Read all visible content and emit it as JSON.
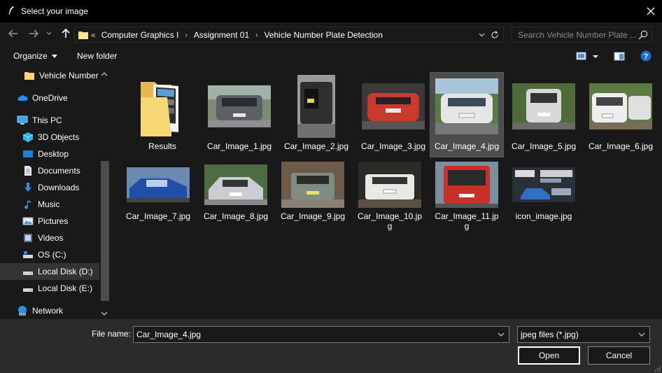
{
  "window": {
    "title": "Select your image",
    "close_icon": "close-icon"
  },
  "address": {
    "overflow": "«",
    "crumbs": [
      "Computer Graphics I",
      "Assignment 01",
      "Vehicle Number Plate Detection"
    ]
  },
  "search": {
    "placeholder": "Search Vehicle Number Plate ..."
  },
  "toolbar": {
    "organize": "Organize",
    "new_folder": "New folder"
  },
  "sidebar": {
    "items": [
      {
        "label": "Vehicle Number",
        "icon": "folder-icon"
      },
      {
        "label": "OneDrive",
        "icon": "cloud-icon"
      },
      {
        "label": "This PC",
        "icon": "computer-icon"
      },
      {
        "label": "3D Objects",
        "icon": "cube-icon"
      },
      {
        "label": "Desktop",
        "icon": "desktop-icon"
      },
      {
        "label": "Documents",
        "icon": "document-icon"
      },
      {
        "label": "Downloads",
        "icon": "download-icon"
      },
      {
        "label": "Music",
        "icon": "music-icon"
      },
      {
        "label": "Pictures",
        "icon": "pictures-icon"
      },
      {
        "label": "Videos",
        "icon": "videos-icon"
      },
      {
        "label": "OS (C:)",
        "icon": "drive-icon"
      },
      {
        "label": "Local Disk (D:)",
        "icon": "drive-icon"
      },
      {
        "label": "Local Disk (E:)",
        "icon": "drive-icon"
      },
      {
        "label": "Network",
        "icon": "network-icon"
      }
    ]
  },
  "files": [
    {
      "name": "Results"
    },
    {
      "name": "Car_Image_1.jpg"
    },
    {
      "name": "Car_Image_2.jpg"
    },
    {
      "name": "Car_Image_3.jpg"
    },
    {
      "name": "Car_Image_4.jpg"
    },
    {
      "name": "Car_Image_5.jpg"
    },
    {
      "name": "Car_Image_6.jpg"
    },
    {
      "name": "Car_Image_7.jpg"
    },
    {
      "name": "Car_Image_8.jpg"
    },
    {
      "name": "Car_Image_9.jpg"
    },
    {
      "name": "Car_Image_10.jpg",
      "label_line1": "Car_Image_10.jp",
      "label_line2": "g"
    },
    {
      "name": "Car_Image_11.jpg",
      "label_line1": "Car_Image_11.jp",
      "label_line2": "g"
    },
    {
      "name": "icon_image.jpg"
    }
  ],
  "footer": {
    "file_name_label": "File name:",
    "file_name_value": "Car_Image_4.jpg",
    "file_type": "jpeg files (*.jpg)",
    "open": "Open",
    "cancel": "Cancel"
  },
  "colors": {
    "background": "#191919",
    "titlebar": "#000000",
    "footer": "#2b2b2b",
    "selection": "#4d4d4d",
    "folder": "#f8d775",
    "accent_blue": "#1e90ff",
    "help_blue": "#1b6fd1"
  }
}
